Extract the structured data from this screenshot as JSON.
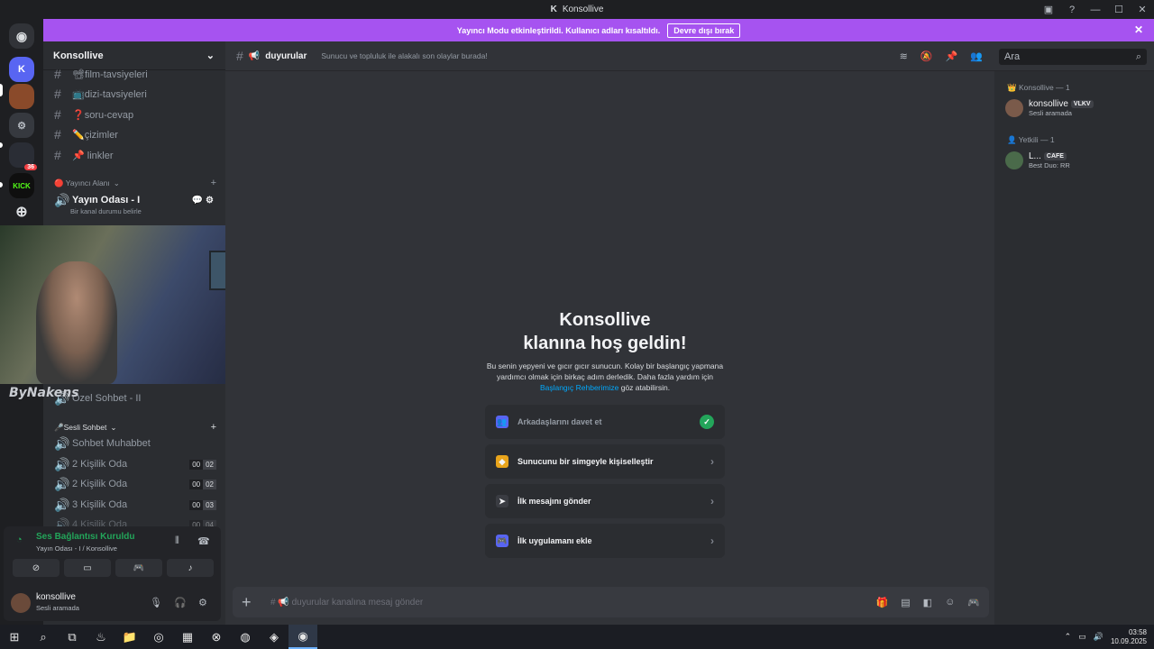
{
  "window": {
    "title": "Konsollive",
    "logo": "K"
  },
  "banner": {
    "text": "Yayıncı Modu etkinleştirildi. Kullanıcı adları kısaltıldı.",
    "button": "Devre dışı bırak"
  },
  "rail": {
    "servers": [
      {
        "label": "K",
        "color": "#5865f2"
      },
      {
        "label": "",
        "color": "#8a4a2a"
      },
      {
        "label": "",
        "color": "#36393f"
      },
      {
        "label": "",
        "color": "#2a2d35",
        "badge": "36"
      },
      {
        "label": "KICK",
        "color": "#0f0f0f"
      }
    ]
  },
  "sidebar": {
    "server_name": "Konsollive",
    "text_channels": [
      {
        "name": "📽film-tavsiyeleri"
      },
      {
        "name": "📺dizi-tavsiyeleri"
      },
      {
        "name": "❓soru-cevap"
      },
      {
        "name": "✏️çizimler"
      },
      {
        "name": "📌 linkler"
      }
    ],
    "streamer_category": "🔴 Yayıncı Alanı",
    "stream_room": {
      "name": "Yayın Odası - I",
      "status": "Bir kanal durumu belirle"
    },
    "private_chat": "Özel Sohbet - II",
    "voice_category": "🎤Sesli Sohbet",
    "voice_channels": [
      {
        "name": "Sohbet Muhabbet",
        "a": "",
        "b": ""
      },
      {
        "name": "2 Kişilik Oda",
        "a": "00",
        "b": "02"
      },
      {
        "name": "2 Kişilik Oda",
        "a": "00",
        "b": "02"
      },
      {
        "name": "3 Kişilik Oda",
        "a": "00",
        "b": "03"
      },
      {
        "name": "4 Kişilik Oda",
        "a": "00",
        "b": "04"
      }
    ]
  },
  "voice": {
    "status": "Ses Bağlantısı Kuruldu",
    "location": "Yayın Odası - I / Konsollive"
  },
  "user": {
    "name": "konsollive",
    "status": "Sesli aramada"
  },
  "channel": {
    "name": "duyurular",
    "topic": "Sunucu ve topluluk ile alakalı son olaylar burada!",
    "search_placeholder": "Ara"
  },
  "welcome": {
    "title_line1": "Konsollive",
    "title_line2": "klanına hoş geldin!",
    "desc": "Bu senin yepyeni ve gıcır gıcır sunucun. Kolay bir başlangıç yapmana yardımcı olmak için birkaç adım derledik. Daha fazla yardım için",
    "link": "Başlangıç Rehberimize",
    "desc_end": "göz atabilirsin."
  },
  "todos": [
    {
      "label": "Arkadaşlarını davet et",
      "done": true
    },
    {
      "label": "Sunucunu bir simgeyle kişiselleştir",
      "done": false
    },
    {
      "label": "İlk mesajını gönder",
      "done": false
    },
    {
      "label": "İlk uygulamanı ekle",
      "done": false
    }
  ],
  "composer": {
    "placeholder": "# 📢 duyurular kanalına mesaj gönder"
  },
  "members": {
    "group1": "👑 Konsollive — 1",
    "m1": {
      "name": "konsollive",
      "tag": "VLKV",
      "status": "Sesli aramada"
    },
    "group2": "👤 Yetkili — 1",
    "m2": {
      "name": "L...",
      "tag": "CAFE",
      "status": "Best Duo: RR"
    }
  },
  "cam_logo": "ByNakens",
  "clock": {
    "time": "03:58",
    "date": "10.09.2025"
  },
  "colors": {
    "accent": "#5865f2",
    "banner": "#a653f0",
    "online": "#23a55a"
  }
}
